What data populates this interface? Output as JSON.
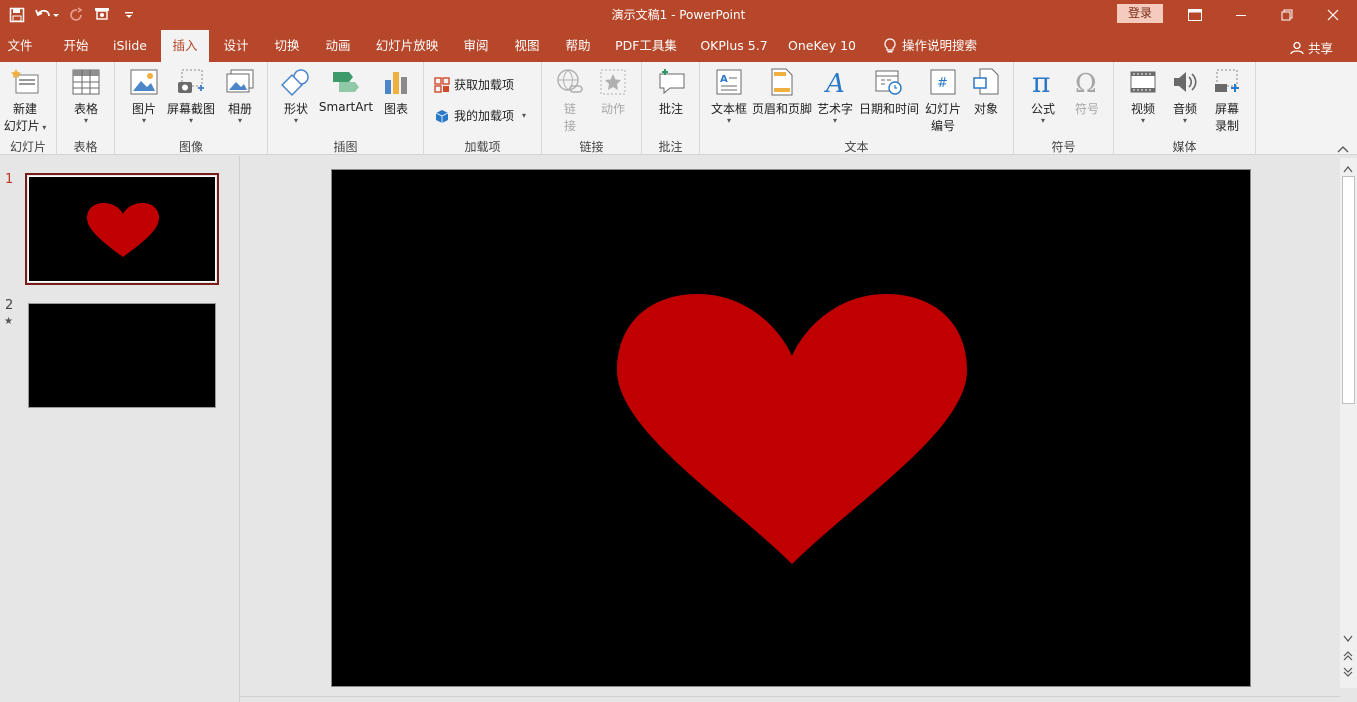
{
  "title_bar": {
    "document_title": "演示文稿1  -  PowerPoint",
    "login_label": "登录"
  },
  "tabs": [
    {
      "label": "文件"
    },
    {
      "label": "开始"
    },
    {
      "label": "iSlide"
    },
    {
      "label": "插入"
    },
    {
      "label": "设计"
    },
    {
      "label": "切换"
    },
    {
      "label": "动画"
    },
    {
      "label": "幻灯片放映"
    },
    {
      "label": "审阅"
    },
    {
      "label": "视图"
    },
    {
      "label": "帮助"
    },
    {
      "label": "PDF工具集"
    },
    {
      "label": "OKPlus 5.7"
    },
    {
      "label": "OneKey 10"
    },
    {
      "label": "操作说明搜索"
    }
  ],
  "share_label": "共享",
  "ribbon": {
    "groups": {
      "slides": "幻灯片",
      "tables": "表格",
      "images": "图像",
      "illustrations": "插图",
      "addins": "加载项",
      "links": "链接",
      "comments": "批注",
      "text": "文本",
      "symbols": "符号",
      "media": "媒体"
    },
    "buttons": {
      "new_slide_1": "新建",
      "new_slide_2": "幻灯片",
      "table": "表格",
      "picture": "图片",
      "screenshot": "屏幕截图",
      "album": "相册",
      "shapes": "形状",
      "smartart": "SmartArt",
      "chart": "图表",
      "get_addins": "获取加载项",
      "my_addins": "我的加载项",
      "link_1": "链",
      "link_2": "接",
      "action": "动作",
      "comment": "批注",
      "textbox": "文本框",
      "header_footer": "页眉和页脚",
      "wordart": "艺术字",
      "datetime": "日期和时间",
      "slidenum_1": "幻灯片",
      "slidenum_2": "编号",
      "object": "对象",
      "equation": "公式",
      "symbol": "符号",
      "video": "视频",
      "audio": "音频",
      "screenrec_1": "屏幕",
      "screenrec_2": "录制"
    }
  },
  "slides": [
    {
      "number": "1",
      "selected": true,
      "has_heart": true
    },
    {
      "number": "2",
      "selected": false,
      "has_star": true
    }
  ],
  "colors": {
    "accent": "#b7472a",
    "heart": "#c00000",
    "slide_bg": "#000000"
  }
}
